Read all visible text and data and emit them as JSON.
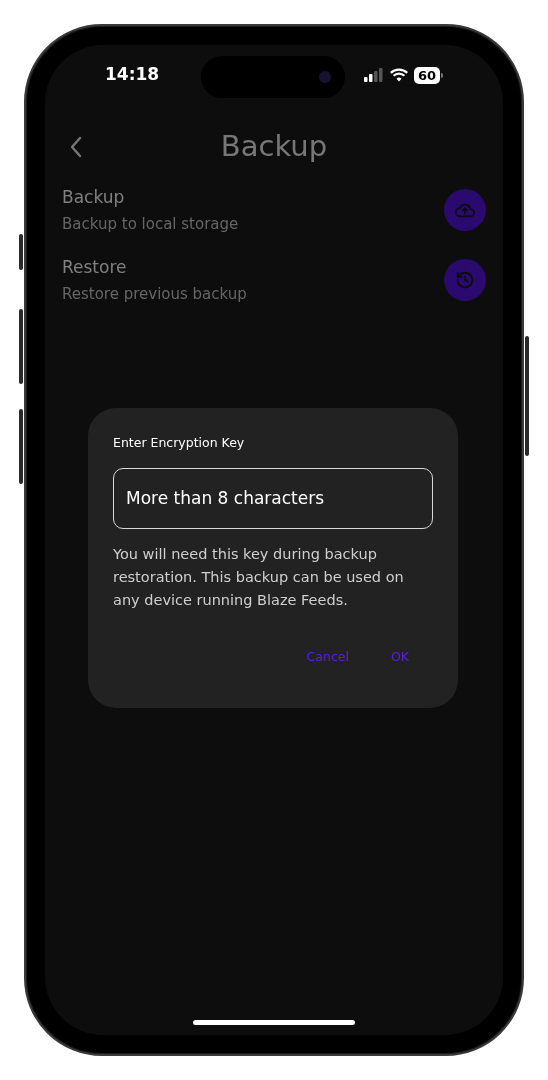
{
  "status_bar": {
    "time": "14:18",
    "battery": "60"
  },
  "header": {
    "title": "Backup"
  },
  "options": [
    {
      "title": "Backup",
      "subtitle": "Backup to local storage",
      "kind": "upload"
    },
    {
      "title": "Restore",
      "subtitle": "Restore previous backup",
      "kind": "restore"
    }
  ],
  "dialog": {
    "title": "Enter Encryption Key",
    "field": {
      "placeholder": "More than 8 characters"
    },
    "message": "You will need this key during backup restoration. This backup can be used on any device running Blaze Feeds.",
    "buttons": [
      "Cancel",
      "OK"
    ]
  }
}
